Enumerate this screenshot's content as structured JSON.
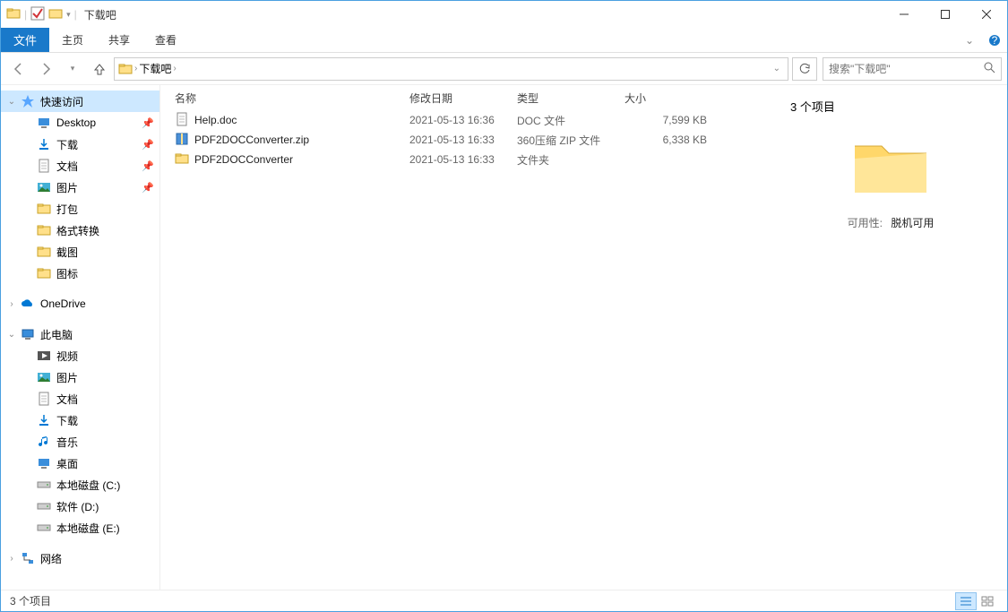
{
  "window": {
    "title": "下载吧"
  },
  "ribbon": {
    "file": "文件",
    "tabs": [
      "主页",
      "共享",
      "查看"
    ]
  },
  "nav": {
    "path": [
      "下载吧"
    ],
    "search_placeholder": "搜索\"下载吧\""
  },
  "sidebar": {
    "quick_access": "快速访问",
    "onedrive": "OneDrive",
    "this_pc": "此电脑",
    "network": "网络",
    "quick_items": [
      {
        "label": "Desktop",
        "pinned": true,
        "icon": "desktop"
      },
      {
        "label": "下载",
        "pinned": true,
        "icon": "download"
      },
      {
        "label": "文档",
        "pinned": true,
        "icon": "doc"
      },
      {
        "label": "图片",
        "pinned": true,
        "icon": "pic"
      },
      {
        "label": "打包",
        "pinned": false,
        "icon": "folder"
      },
      {
        "label": "格式转换",
        "pinned": false,
        "icon": "folder"
      },
      {
        "label": "截图",
        "pinned": false,
        "icon": "folder"
      },
      {
        "label": "图标",
        "pinned": false,
        "icon": "folder"
      }
    ],
    "pc_items": [
      {
        "label": "视频",
        "icon": "video"
      },
      {
        "label": "图片",
        "icon": "pic"
      },
      {
        "label": "文档",
        "icon": "doc"
      },
      {
        "label": "下载",
        "icon": "download"
      },
      {
        "label": "音乐",
        "icon": "music"
      },
      {
        "label": "桌面",
        "icon": "desktop"
      },
      {
        "label": "本地磁盘 (C:)",
        "icon": "drive"
      },
      {
        "label": "软件 (D:)",
        "icon": "drive"
      },
      {
        "label": "本地磁盘 (E:)",
        "icon": "drive"
      }
    ]
  },
  "columns": {
    "name": "名称",
    "date": "修改日期",
    "type": "类型",
    "size": "大小"
  },
  "files": [
    {
      "name": "Help.doc",
      "date": "2021-05-13 16:36",
      "type": "DOC 文件",
      "size": "7,599 KB",
      "icon": "doc"
    },
    {
      "name": "PDF2DOCConverter.zip",
      "date": "2021-05-13 16:33",
      "type": "360压缩 ZIP 文件",
      "size": "6,338 KB",
      "icon": "zip"
    },
    {
      "name": "PDF2DOCConverter",
      "date": "2021-05-13 16:33",
      "type": "文件夹",
      "size": "",
      "icon": "folder"
    }
  ],
  "details": {
    "count": "3 个项目",
    "avail_label": "可用性:",
    "avail_value": "脱机可用"
  },
  "status": {
    "count": "3 个项目"
  }
}
